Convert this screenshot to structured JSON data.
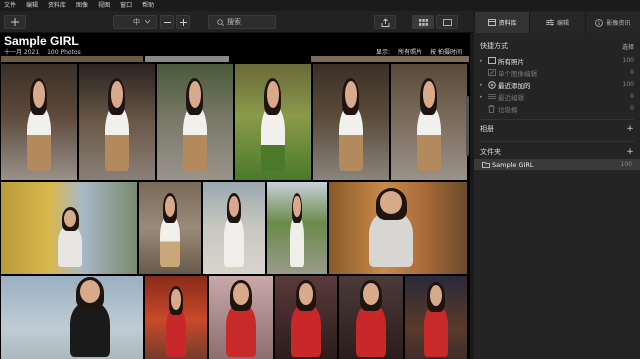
{
  "menu": [
    "文件",
    "编辑",
    "资料库",
    "图像",
    "视图",
    "窗口",
    "帮助"
  ],
  "toolbar": {
    "size_label": "中",
    "search_label": "搜索"
  },
  "right_tabs": [
    {
      "label": "资料库"
    },
    {
      "label": "编辑"
    },
    {
      "label": "影像资讯"
    }
  ],
  "library": {
    "title": "Sample GIRL",
    "date": "十一月 2021",
    "count": "100 Photos",
    "show_label": "显示:",
    "show_value": "所有照片",
    "sort_value": "按 拍摄时间"
  },
  "panel": {
    "shortcuts_title": "快捷方式",
    "select_label": "选择",
    "shortcuts": [
      {
        "label": "所有照片",
        "count": "100",
        "dim": false,
        "icon": "photos-icon"
      },
      {
        "label": "单个图像编辑",
        "count": "0",
        "dim": true,
        "icon": "single-edit-icon"
      },
      {
        "label": "最近添加的",
        "count": "100",
        "dim": false,
        "icon": "recent-icon"
      },
      {
        "label": "最近编辑",
        "count": "0",
        "dim": true,
        "icon": "recent-edit-icon"
      },
      {
        "label": "垃圾桶",
        "count": "0",
        "dim": true,
        "icon": "trash-icon"
      }
    ],
    "albums_title": "相册",
    "folders_title": "文件夹",
    "folders": [
      {
        "label": "Sample GIRL",
        "count": "100"
      }
    ]
  }
}
